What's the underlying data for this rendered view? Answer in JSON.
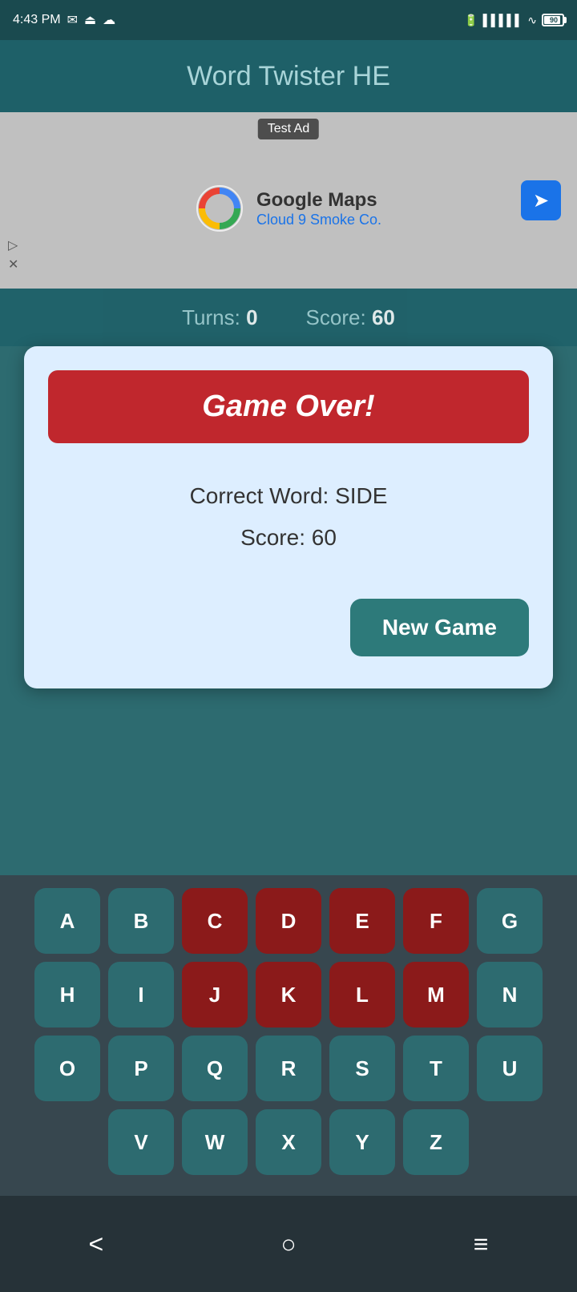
{
  "statusBar": {
    "time": "4:43 PM",
    "battery": "90"
  },
  "appTitle": "Word Twister HE",
  "ad": {
    "label": "Test Ad",
    "advertiserName": "Google Maps",
    "advertiserSub": "Cloud 9 Smoke Co."
  },
  "scoreBar": {
    "turnsLabel": "Turns:",
    "turnsValue": "0",
    "scoreLabel": "Score:",
    "scoreValue": "60"
  },
  "modal": {
    "gameOverLabel": "Game Over!",
    "correctWordLabel": "Correct Word: SIDE",
    "scoreLabel": "Score: 60",
    "newGameLabel": "New Game"
  },
  "keyboard": {
    "rows": [
      [
        "A",
        "B",
        "C",
        "D",
        "E",
        "F",
        "G"
      ],
      [
        "H",
        "I",
        "J",
        "K",
        "L",
        "M",
        "N"
      ],
      [
        "O",
        "P",
        "Q",
        "R",
        "S",
        "T",
        "U"
      ],
      [
        "V",
        "W",
        "X",
        "Y",
        "Z"
      ]
    ],
    "usedKeys": [
      "C",
      "D",
      "E",
      "F",
      "J",
      "K",
      "L",
      "M"
    ]
  },
  "navBar": {
    "backLabel": "<",
    "homeLabel": "○",
    "menuLabel": "≡"
  }
}
